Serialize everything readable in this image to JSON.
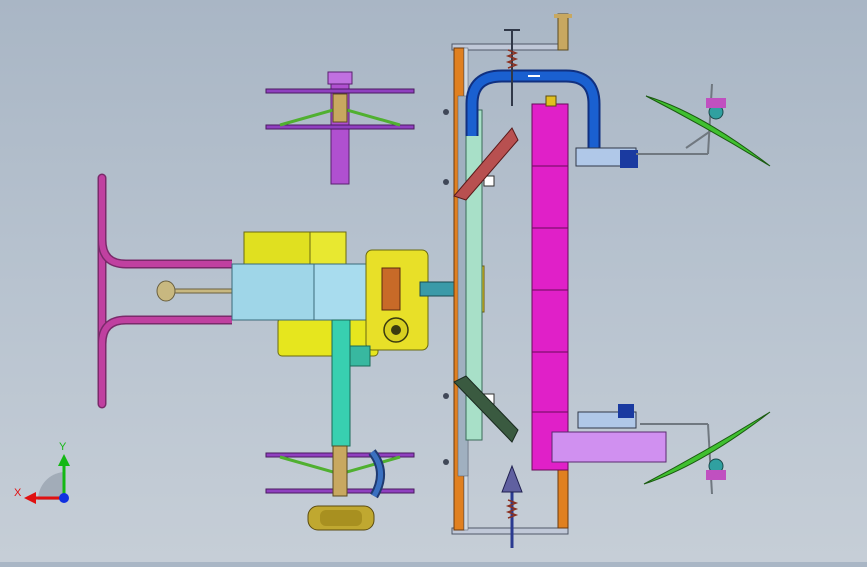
{
  "viewport": {
    "background_top": "#a9b6c5",
    "background_bottom": "#c6ced7"
  },
  "triad": {
    "x_label": "X",
    "y_label": "Y",
    "x_color": "#e01010",
    "y_color": "#14b814",
    "z_color": "#1030e0"
  },
  "parts": {
    "handlebar": "#c040a0",
    "frame_cyan": "#9fd6e8",
    "engine_yellow": "#e6e61e",
    "tine_purple": "#9040c0",
    "shaft_green": "#38d0b0",
    "roller_magenta": "#e020c8",
    "hose_blue": "#1a60d0",
    "frame_orange": "#e08020",
    "blade_green": "#40c030",
    "deck_violet": "#d090f0",
    "wheel_olive": "#c0a830"
  }
}
